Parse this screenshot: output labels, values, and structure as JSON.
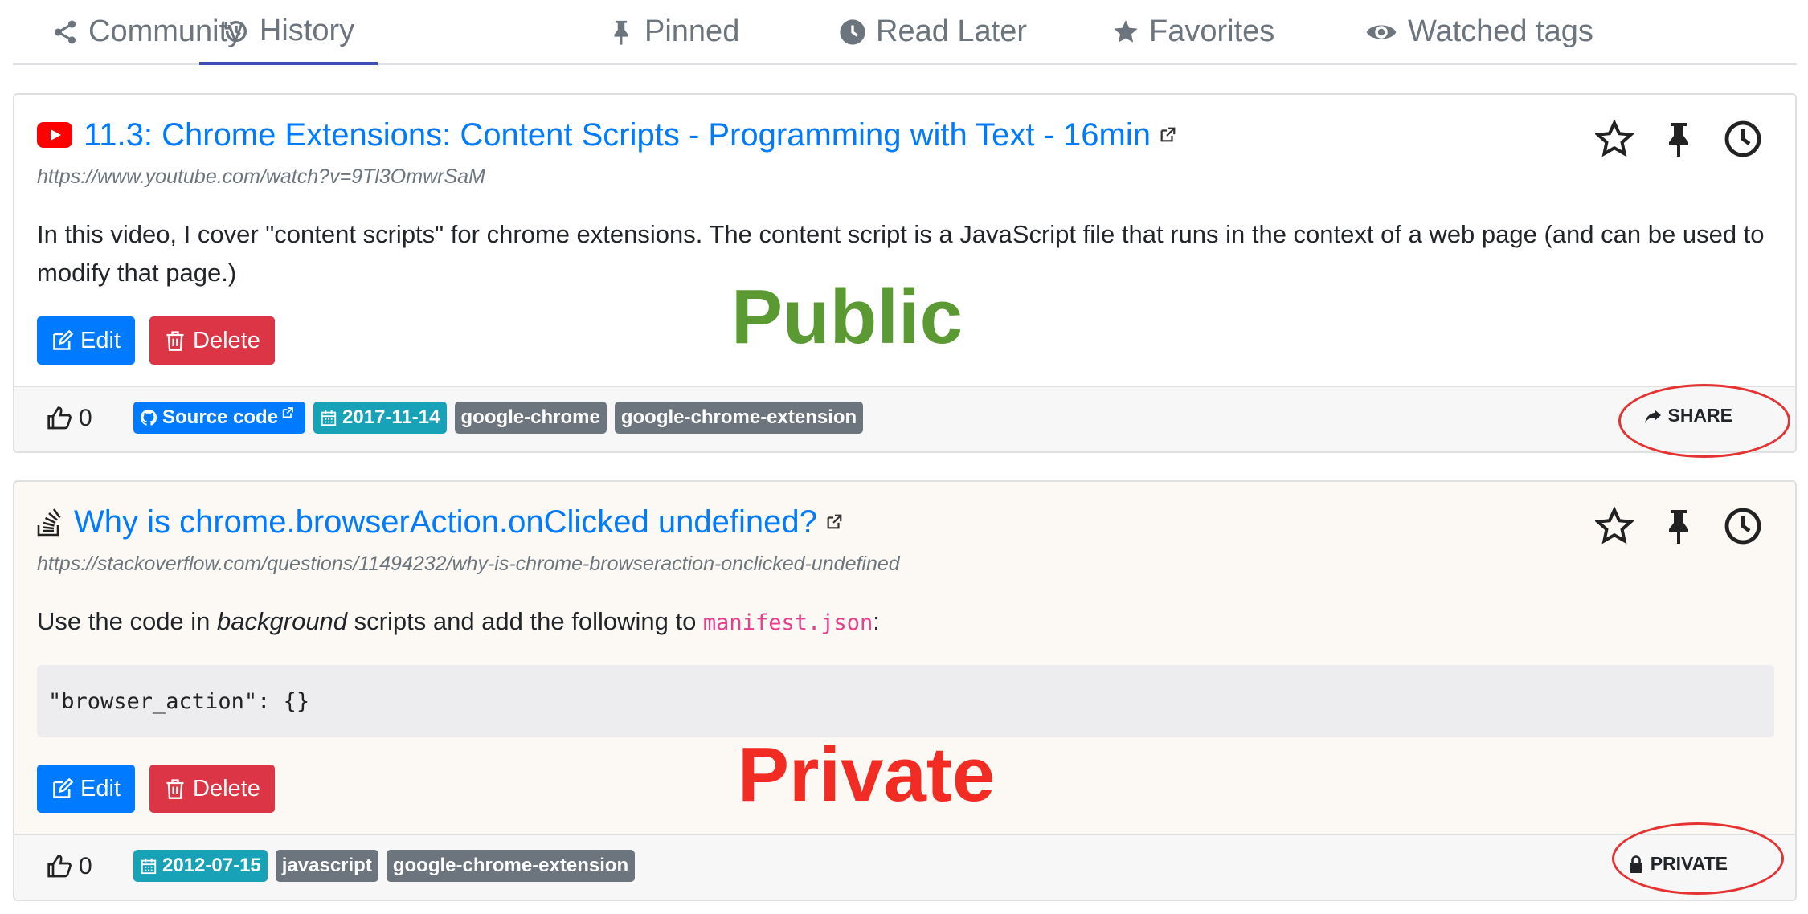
{
  "tabs": [
    {
      "label": "Community",
      "icon": "share-nodes-icon"
    },
    {
      "label": "History",
      "icon": "history-icon",
      "active": true
    },
    {
      "label": "Pinned",
      "icon": "thumbtack-icon"
    },
    {
      "label": "Read Later",
      "icon": "clock-icon"
    },
    {
      "label": "Favorites",
      "icon": "star-icon"
    },
    {
      "label": "Watched tags",
      "icon": "eye-icon"
    }
  ],
  "bookmarks": [
    {
      "site_icon": "youtube-icon",
      "title": "11.3: Chrome Extensions: Content Scripts - Programming with Text - 16min",
      "url": "https://www.youtube.com/watch?v=9Tl3OmwrSaM",
      "description": "In this video, I cover \"content scripts\" for chrome extensions. The content script is a JavaScript file that runs in the context of a web page (and can be used to modify that page.)",
      "edit_label": "Edit",
      "delete_label": "Delete",
      "likes": "0",
      "source_code_label": "Source code",
      "date": "2017-11-14",
      "tags": [
        "google-chrome",
        "google-chrome-extension"
      ],
      "footer_action": "SHARE",
      "annotation": "Public"
    },
    {
      "site_icon": "stackoverflow-icon",
      "title": "Why is chrome.browserAction.onClicked undefined?",
      "url": "https://stackoverflow.com/questions/11494232/why-is-chrome-browseraction-onclicked-undefined",
      "description_before": "Use the code in ",
      "description_em": "background",
      "description_middle": " scripts and add the following to ",
      "description_code": "manifest.json",
      "description_after": ":",
      "code_block": "\"browser_action\": {}",
      "edit_label": "Edit",
      "delete_label": "Delete",
      "likes": "0",
      "date": "2012-07-15",
      "tags": [
        "javascript",
        "google-chrome-extension"
      ],
      "footer_action": "PRIVATE",
      "annotation": "Private"
    }
  ],
  "colors": {
    "link": "#007bff",
    "danger": "#dc3545",
    "info": "#17a2b8",
    "secondary": "#6c757d",
    "annotation_public": "#5b9a33",
    "annotation_private": "#f22c22",
    "ellipse": "#e53232",
    "active_tab": "#3f51b5"
  }
}
